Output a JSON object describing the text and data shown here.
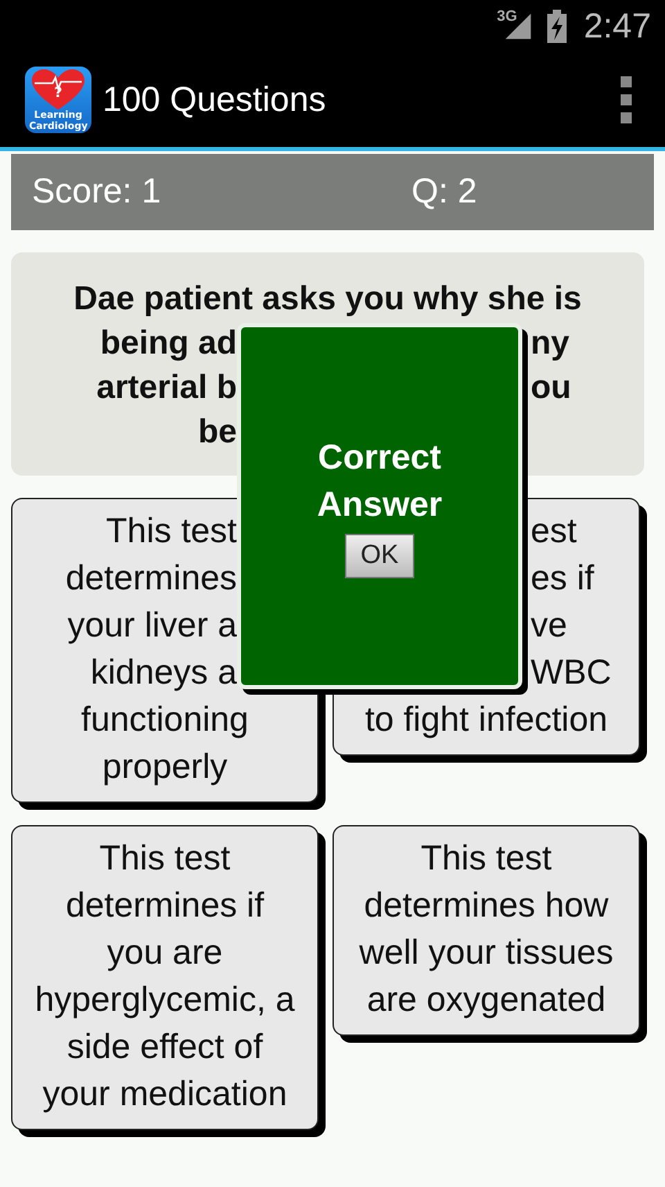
{
  "status_bar": {
    "network": "3G",
    "time": "2:47"
  },
  "action_bar": {
    "logo_mark": "?",
    "logo_text": "Learning Cardiology",
    "title": "100 Questions"
  },
  "score_bar": {
    "score": "Score: 1",
    "question": "Q: 2"
  },
  "question": {
    "lines": [
      {
        "left": "Dae patient asks you why she is"
      },
      {
        "left": "being ad",
        "right": "ny"
      },
      {
        "left": "arterial b",
        "right": "ou"
      },
      {
        "left": "be"
      }
    ]
  },
  "answers": [
    {
      "lines": [
        {
          "text": "This test",
          "covered": true
        },
        {
          "text": "determines",
          "covered": true
        },
        {
          "text": "your liver a",
          "covered": true
        },
        {
          "text": "kidneys a",
          "covered": true
        },
        {
          "text": "functioning",
          "covered": false
        },
        {
          "text": "properly",
          "covered": false
        }
      ]
    },
    {
      "lines": [
        {
          "text": "est",
          "covered": true
        },
        {
          "text": "es if",
          "covered": true
        },
        {
          "text": "ve",
          "covered": true
        },
        {
          "text": "WBC",
          "covered": true
        },
        {
          "text": "to fight infection",
          "covered": false
        }
      ]
    },
    {
      "lines": [
        {
          "text": "This test",
          "covered": false
        },
        {
          "text": "determines if",
          "covered": false
        },
        {
          "text": "you are",
          "covered": false
        },
        {
          "text": "hyperglycemic, a",
          "covered": false
        },
        {
          "text": "side effect of",
          "covered": false
        },
        {
          "text": "your medication",
          "covered": false
        }
      ]
    },
    {
      "lines": [
        {
          "text": "This test",
          "covered": false
        },
        {
          "text": "determines how",
          "covered": false
        },
        {
          "text": "well your tissues",
          "covered": false
        },
        {
          "text": "are oxygenated",
          "covered": false
        }
      ]
    }
  ],
  "dialog": {
    "title": "Correct Answer",
    "button": "OK"
  }
}
